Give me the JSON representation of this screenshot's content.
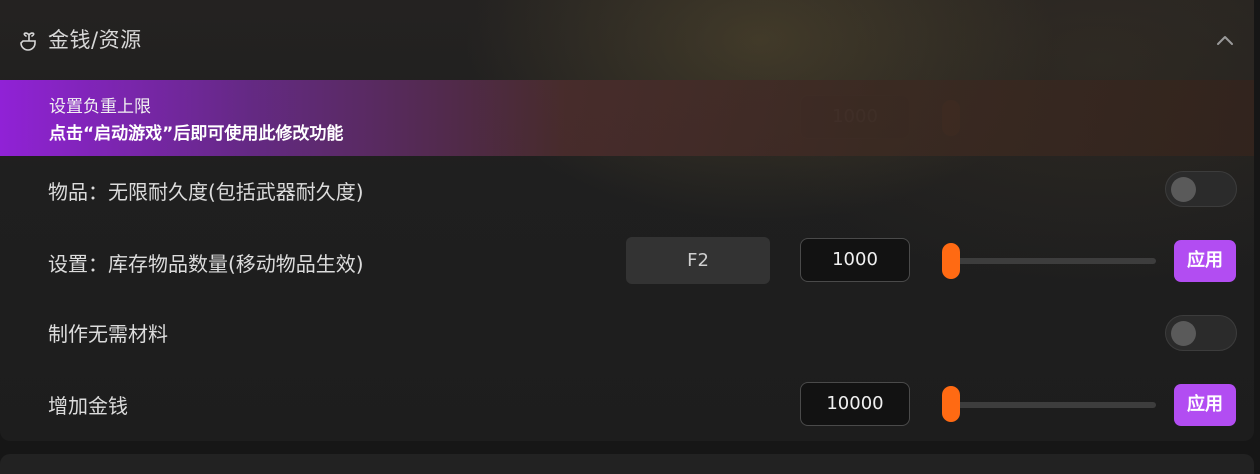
{
  "section": {
    "title": "金钱/资源",
    "icon": "gift-icon",
    "collapse_icon": "chevron-up-icon"
  },
  "banner": {
    "line1": "设置负重上限",
    "line2": "点击“启动游戏”后即可使用此修改功能",
    "hidden_value": "1000"
  },
  "rows": [
    {
      "label": "物品：无限耐久度(包括武器耐久度)",
      "type": "toggle",
      "on": false
    },
    {
      "label": "设置：库存物品数量(移动物品生效)",
      "type": "slider",
      "hotkey": "F2",
      "value": "1000",
      "slider_level": 0,
      "apply_label": "应用"
    },
    {
      "label": "制作无需材料",
      "type": "toggle",
      "on": false
    },
    {
      "label": "增加金钱",
      "type": "slider",
      "value": "10000",
      "slider_level": 0,
      "apply_label": "应用"
    }
  ],
  "colors": {
    "accent_purple": "#b24df2",
    "slider_orange": "#ff6a13"
  }
}
